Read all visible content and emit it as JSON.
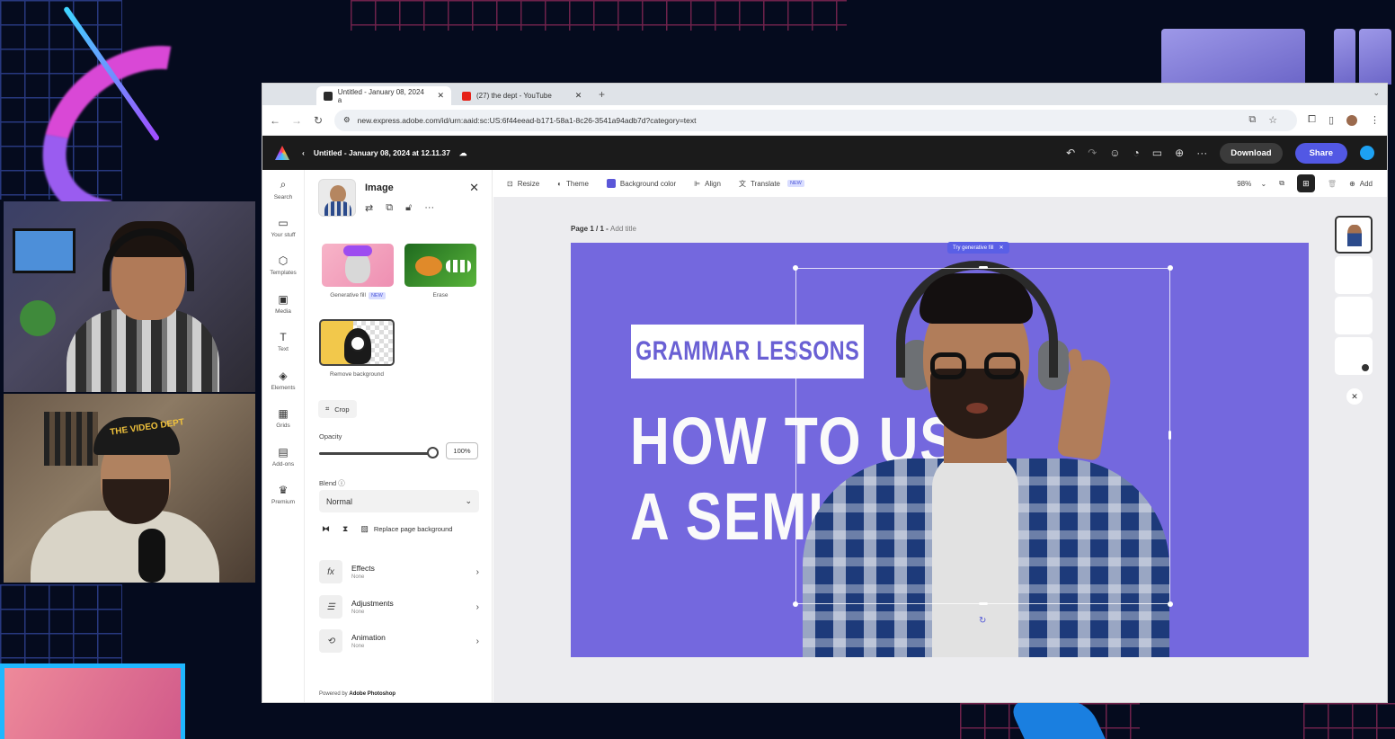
{
  "browser": {
    "tabs": [
      {
        "label": "Untitled - January 08, 2024 a",
        "favicon_color": "#2b2b2b"
      },
      {
        "label": "(27) the dept - YouTube",
        "favicon_color": "#e62117"
      }
    ],
    "new_tab": "+",
    "url": "new.express.adobe.com/id/urn:aaid:sc:US:6f44eead-b171-58a1-8c26-3541a94adb7d?category=text"
  },
  "header": {
    "doc_title": "Untitled - January 08, 2024 at 12.11.37",
    "download": "Download",
    "share": "Share"
  },
  "rail": [
    {
      "icon": "search-icon",
      "glyph": "⌕",
      "label": "Search"
    },
    {
      "icon": "folder-icon",
      "glyph": "▭",
      "label": "Your stuff"
    },
    {
      "icon": "templates-icon",
      "glyph": "⬡",
      "label": "Templates"
    },
    {
      "icon": "media-icon",
      "glyph": "▣",
      "label": "Media"
    },
    {
      "icon": "text-icon",
      "glyph": "T",
      "label": "Text"
    },
    {
      "icon": "elements-icon",
      "glyph": "◈",
      "label": "Elements"
    },
    {
      "icon": "grids-icon",
      "glyph": "▦",
      "label": "Grids"
    },
    {
      "icon": "addons-icon",
      "glyph": "▤",
      "label": "Add-ons"
    },
    {
      "icon": "premium-icon",
      "glyph": "♛",
      "label": "Premium"
    }
  ],
  "panel": {
    "title": "Image",
    "gen_fill": "Generative fill",
    "new_badge": "NEW",
    "erase": "Erase",
    "remove_bg": "Remove background",
    "crop": "Crop",
    "opacity_label": "Opacity",
    "opacity_value": "100%",
    "opacity_level": 1.0,
    "blend_label": "Blend",
    "blend_value": "Normal",
    "replace_bg": "Replace page background",
    "effects": {
      "name": "Effects",
      "value": "None"
    },
    "adjustments": {
      "name": "Adjustments",
      "value": "None"
    },
    "animation": {
      "name": "Animation",
      "value": "None"
    },
    "powered_prefix": "Powered by",
    "powered_brand": "Adobe Photoshop"
  },
  "toolbar": {
    "resize": "Resize",
    "theme": "Theme",
    "bg_color": "Background color",
    "align": "Align",
    "translate": "Translate",
    "translate_badge": "NEW",
    "zoom": "98%",
    "add": "Add"
  },
  "canvas": {
    "page_label": "Page 1 / 1 - ",
    "page_sub": "Add title",
    "grammar": "GRAMMAR LESSONS",
    "line1": "HOW TO US",
    "line2": "A SEMI",
    "try_gen_fill": "Try generative fill",
    "bg_color": "#7468de"
  },
  "webcam": {
    "cap_text": "THE VIDEO DEPT"
  }
}
